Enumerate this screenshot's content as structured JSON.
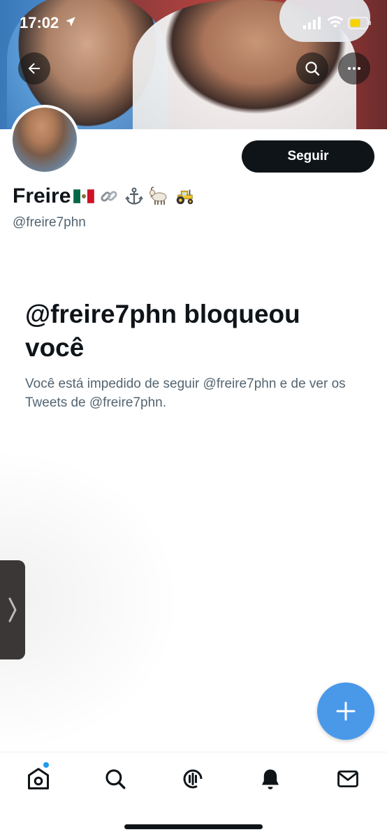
{
  "status_bar": {
    "time": "17:02"
  },
  "header": {
    "back_icon": "arrow-left-icon",
    "search_icon": "search-icon",
    "more_icon": "more-horizontal-icon"
  },
  "profile": {
    "display_name": "Freire",
    "emojis": [
      "flag-mexico",
      "chain-link",
      "anchor",
      "goat",
      "tractor"
    ],
    "handle": "@freire7phn",
    "follow_label": "Seguir"
  },
  "blocked": {
    "title": "@freire7phn bloqueou você",
    "description": "Você está impedido de seguir @freire7phn e de ver os Tweets de @freire7phn."
  },
  "fab": {
    "icon": "plus-icon"
  },
  "tabbar": {
    "items": [
      "home-icon",
      "search-icon",
      "spaces-icon",
      "bell-icon",
      "mail-icon"
    ]
  },
  "colors": {
    "accent": "#1d9bf0",
    "fab": "#4a99e9",
    "text_primary": "#0f1419",
    "text_secondary": "#536471"
  }
}
